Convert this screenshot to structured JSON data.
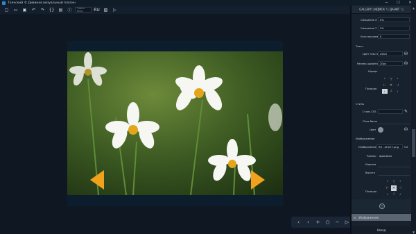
{
  "window": {
    "title": "Толкский © Дивинов визуальный плагин"
  },
  "toolbar": {
    "search_placeholder": "Поиск блок",
    "rating_label": "RU"
  },
  "panel": {
    "header": "GALLERY | ИДМСК ! | ДАНИТ ! |",
    "offset_x_label": "Смещение Х",
    "offset_x_value": "0%",
    "offset_y_label": "Смещение Y",
    "offset_y_value": "0%",
    "angle_label": "Угол наклона",
    "angle_value": "0",
    "text_section": "Текст",
    "text_color_label": "Цвет текста",
    "text_color_value": "#000",
    "font_size_label": "Размер шрифта",
    "font_size_value": "20px",
    "font_label": "Шрифт",
    "position_label": "Позиция",
    "style_section": "Стиль",
    "css_style_label": "Стиль CSS",
    "class_label": "Class Name",
    "bg_color_label": "Цвет",
    "image_section": "Изображение",
    "image_label": "Изображение",
    "image_value": "RU : AHU77.png",
    "size_label": "Размер",
    "size_value": "оригинал",
    "width_label": "Ширина",
    "height_label": "Высота",
    "position2_label": "Позиция",
    "bottom_item1": "Изображение",
    "bottom_item2": "Назад"
  },
  "colors": {
    "accent": "#f0a21c",
    "bg": "#0e1520",
    "panel": "#18222f"
  }
}
